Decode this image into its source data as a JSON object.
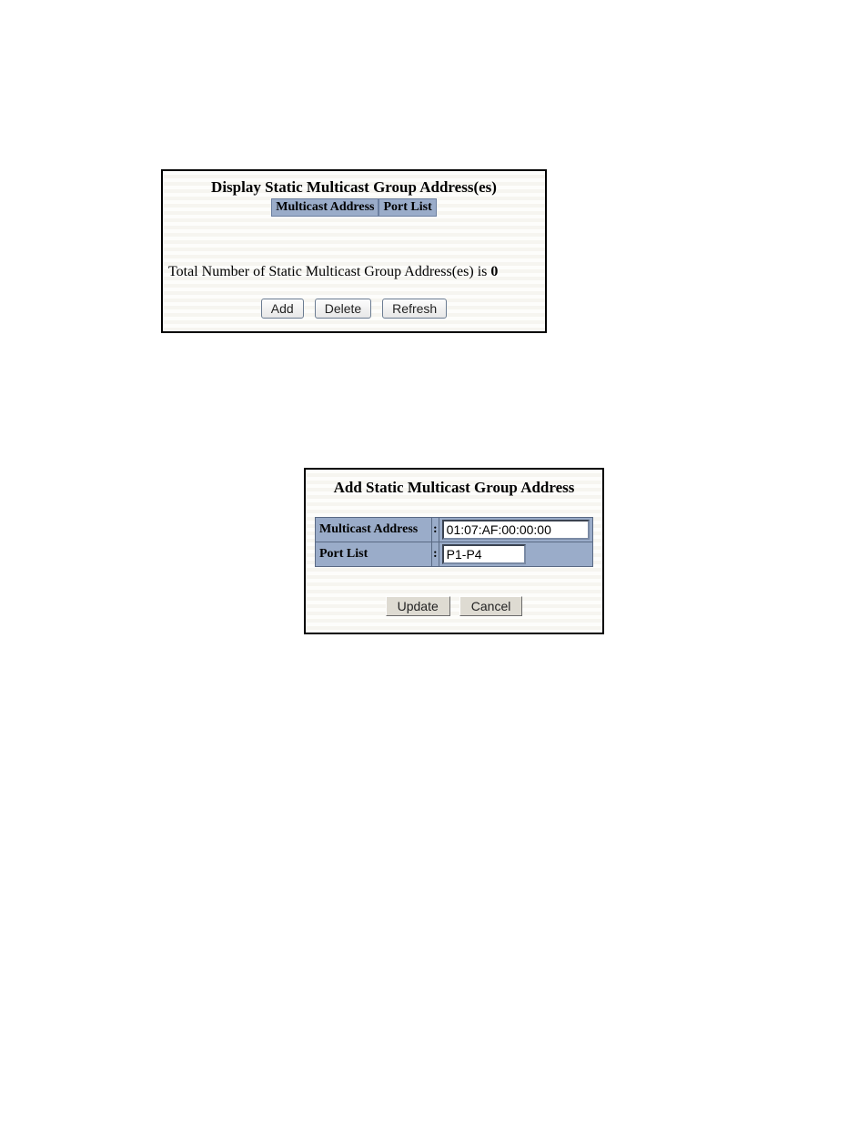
{
  "display_panel": {
    "title": "Display Static Multicast Group Address(es)",
    "headers": {
      "multicast_address": "Multicast Address",
      "port_list": "Port List"
    },
    "total_prefix": "Total Number of Static Multicast Group Address(es) is ",
    "total_count": "0",
    "buttons": {
      "add": "Add",
      "delete": "Delete",
      "refresh": "Refresh"
    }
  },
  "add_panel": {
    "title": "Add Static Multicast Group Address",
    "fields": {
      "multicast_address": {
        "label": "Multicast Address",
        "value": "01:07:AF:00:00:00"
      },
      "port_list": {
        "label": "Port List",
        "value": "P1-P4"
      },
      "colon": ":"
    },
    "buttons": {
      "update": "Update",
      "cancel": "Cancel"
    }
  }
}
